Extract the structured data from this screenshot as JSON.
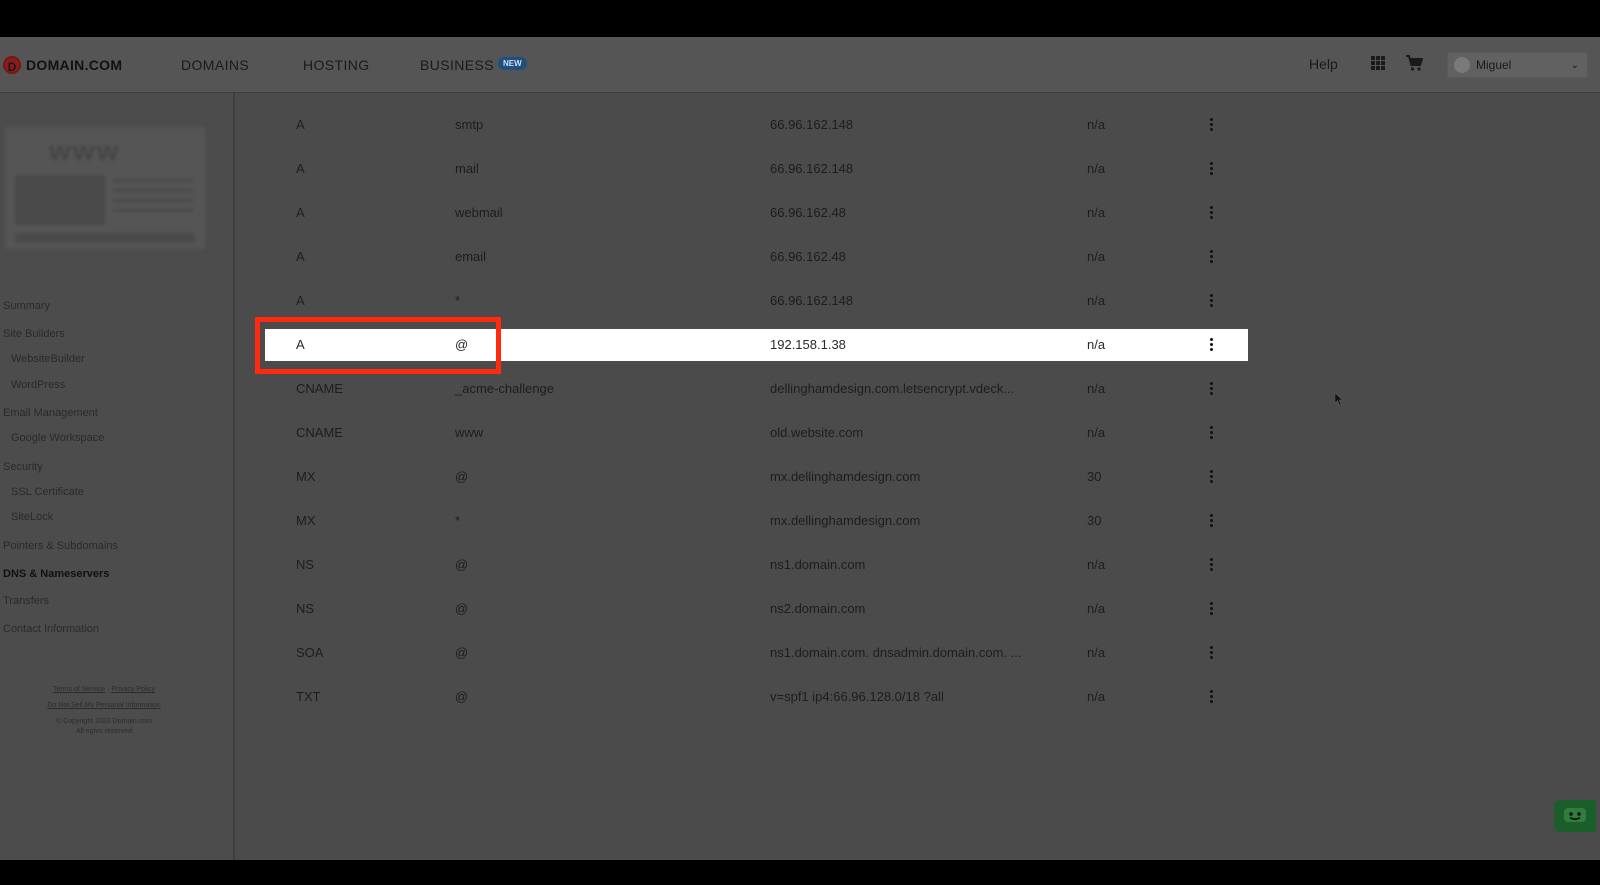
{
  "brand": {
    "logo_letter": "D",
    "name": "DOMAIN.COM"
  },
  "nav": {
    "domains": "DOMAINS",
    "hosting": "HOSTING",
    "business": "BUSINESS",
    "business_badge": "NEW",
    "help": "Help",
    "user_name": "Miguel",
    "chevron": "⌄"
  },
  "icons": {
    "apps": "apps-grid-icon",
    "cart": "cart-icon",
    "user": "avatar-icon",
    "chat": "chat-icon",
    "more": "kebab-icon"
  },
  "sidebar": {
    "thumbnail_text": "www",
    "items": [
      {
        "label": "Summary"
      },
      {
        "label": "Site Builders"
      },
      {
        "label": "WebsiteBuilder"
      },
      {
        "label": "WordPress"
      },
      {
        "label": "Email Management"
      },
      {
        "label": "Google Workspace"
      },
      {
        "label": "Security"
      },
      {
        "label": "SSL Certificate"
      },
      {
        "label": "SiteLock"
      },
      {
        "label": "Pointers & Subdomains"
      },
      {
        "label": "DNS & Nameservers"
      },
      {
        "label": "Transfers"
      },
      {
        "label": "Contact Information"
      }
    ],
    "footer": {
      "terms": "Terms of Service",
      "sep": " · ",
      "privacy": "Privacy Policy",
      "do_not_sell": "Do Not Sell My Personal Information",
      "copyright": "© Copyright 2022 Domain.com",
      "rights": "All rights reserved"
    }
  },
  "dns_records": [
    {
      "type": "A",
      "name": "smtp",
      "content": "66.96.162.148",
      "ttl": "n/a"
    },
    {
      "type": "A",
      "name": "mail",
      "content": "66.96.162.148",
      "ttl": "n/a"
    },
    {
      "type": "A",
      "name": "webmail",
      "content": "66.96.162.48",
      "ttl": "n/a"
    },
    {
      "type": "A",
      "name": "email",
      "content": "66.96.162.48",
      "ttl": "n/a"
    },
    {
      "type": "A",
      "name": "*",
      "content": "66.96.162.148",
      "ttl": "n/a"
    },
    {
      "type": "A",
      "name": "@",
      "content": "192.158.1.38",
      "ttl": "n/a"
    },
    {
      "type": "CNAME",
      "name": "_acme-challenge",
      "content": "dellinghamdesign.com.letsencrypt.vdeck...",
      "ttl": "n/a"
    },
    {
      "type": "CNAME",
      "name": "www",
      "content": "old.website.com",
      "ttl": "n/a"
    },
    {
      "type": "MX",
      "name": "@",
      "content": "mx.dellinghamdesign.com",
      "ttl": "30"
    },
    {
      "type": "MX",
      "name": "*",
      "content": "mx.dellinghamdesign.com",
      "ttl": "30"
    },
    {
      "type": "NS",
      "name": "@",
      "content": "ns1.domain.com",
      "ttl": "n/a"
    },
    {
      "type": "NS",
      "name": "@",
      "content": "ns2.domain.com",
      "ttl": "n/a"
    },
    {
      "type": "SOA",
      "name": "@",
      "content": "ns1.domain.com. dnsadmin.domain.com. ...",
      "ttl": "n/a"
    },
    {
      "type": "TXT",
      "name": "@",
      "content": "v=spf1 ip4:66.96.128.0/18 ?all",
      "ttl": "n/a"
    }
  ],
  "highlighted_record_index": 5,
  "colors": {
    "overlay": "#4b4b4b",
    "highlight_row": "#ffffff",
    "annotation": "#ff2a10",
    "chat": "#1b5e2a"
  }
}
